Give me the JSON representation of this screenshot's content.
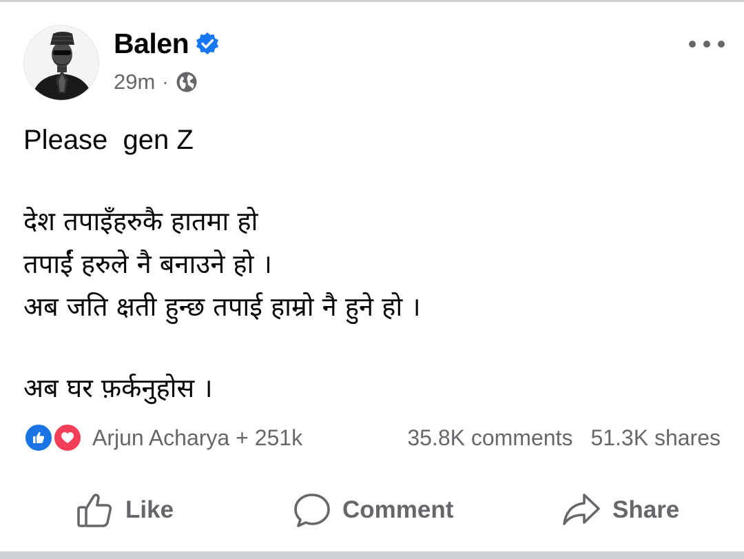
{
  "post": {
    "author": "Balen",
    "verified_icon": "verified-badge-icon",
    "time": "29m",
    "separator": "·",
    "privacy_icon": "globe-icon",
    "text_lines": [
      "Please  gen Z",
      "देश तपाइँहरुकै हातमा हो",
      "तपाईं हरुले नै बनाउने हो ।",
      "अब जति क्षती हुन्छ तपाई हाम्रो नै हुने हो ।",
      "अब घर फ़र्कनुहोस ।"
    ]
  },
  "reactions": {
    "icons": [
      "like-reaction-icon",
      "love-reaction-icon"
    ],
    "summary": "Arjun Acharya + 251k",
    "comments": "35.8K comments",
    "shares": "51.3K shares"
  },
  "actions": {
    "like_label": "Like",
    "comment_label": "Comment",
    "share_label": "Share"
  },
  "colors": {
    "primary_text": "#050505",
    "secondary_text": "#65676b",
    "like_blue": "#1b74e4",
    "love_red": "#f33e58",
    "divider": "#cdd0d4"
  }
}
